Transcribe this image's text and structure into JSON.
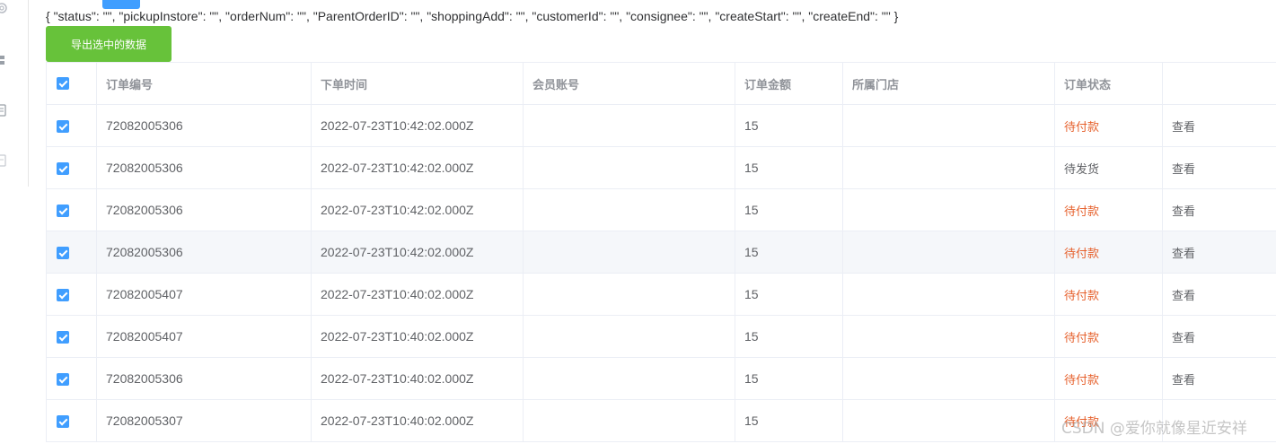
{
  "query": {
    "text": "{ \"status\": \"\", \"pickupInstore\": \"\", \"orderNum\": \"\", \"ParentOrderID\": \"\", \"shoppingAdd\": \"\", \"customerId\": \"\", \"consignee\": \"\", \"createStart\": \"\", \"createEnd\": \"\" }"
  },
  "export_button": {
    "label": "导出选中的数据"
  },
  "table": {
    "headers": {
      "order_no": "订单编号",
      "order_time": "下单时间",
      "member_account": "会员账号",
      "order_amount": "订单金额",
      "store": "所属门店",
      "order_status": "订单状态",
      "actions": ""
    },
    "rows": [
      {
        "order_no": "72082005306",
        "order_time": "2022-07-23T10:42:02.000Z",
        "member_account": "",
        "order_amount": "15",
        "store": "",
        "status": "待付款",
        "status_type": "pending",
        "action": "查看",
        "checked": true
      },
      {
        "order_no": "72082005306",
        "order_time": "2022-07-23T10:42:02.000Z",
        "member_account": "",
        "order_amount": "15",
        "store": "",
        "status": "待发货",
        "status_type": "ship",
        "action": "查看",
        "checked": true
      },
      {
        "order_no": "72082005306",
        "order_time": "2022-07-23T10:42:02.000Z",
        "member_account": "",
        "order_amount": "15",
        "store": "",
        "status": "待付款",
        "status_type": "pending",
        "action": "查看",
        "checked": true
      },
      {
        "order_no": "72082005306",
        "order_time": "2022-07-23T10:42:02.000Z",
        "member_account": "",
        "order_amount": "15",
        "store": "",
        "status": "待付款",
        "status_type": "pending",
        "action": "查看",
        "checked": true,
        "highlight": true
      },
      {
        "order_no": "72082005407",
        "order_time": "2022-07-23T10:40:02.000Z",
        "member_account": "",
        "order_amount": "15",
        "store": "",
        "status": "待付款",
        "status_type": "pending",
        "action": "查看",
        "checked": true
      },
      {
        "order_no": "72082005407",
        "order_time": "2022-07-23T10:40:02.000Z",
        "member_account": "",
        "order_amount": "15",
        "store": "",
        "status": "待付款",
        "status_type": "pending",
        "action": "查看",
        "checked": true
      },
      {
        "order_no": "72082005306",
        "order_time": "2022-07-23T10:40:02.000Z",
        "member_account": "",
        "order_amount": "15",
        "store": "",
        "status": "待付款",
        "status_type": "pending",
        "action": "查看",
        "checked": true
      },
      {
        "order_no": "72082005307",
        "order_time": "2022-07-23T10:40:02.000Z",
        "member_account": "",
        "order_amount": "15",
        "store": "",
        "status": "待付款",
        "status_type": "pending",
        "action": "",
        "checked": true
      }
    ]
  },
  "watermark": {
    "text": "CSDN @爱你就像星近安祥"
  },
  "colors": {
    "primary": "#409eff",
    "success_button": "#67c23a",
    "status_pending": "#e6612d",
    "highlight_row": "#f5f7fa"
  }
}
